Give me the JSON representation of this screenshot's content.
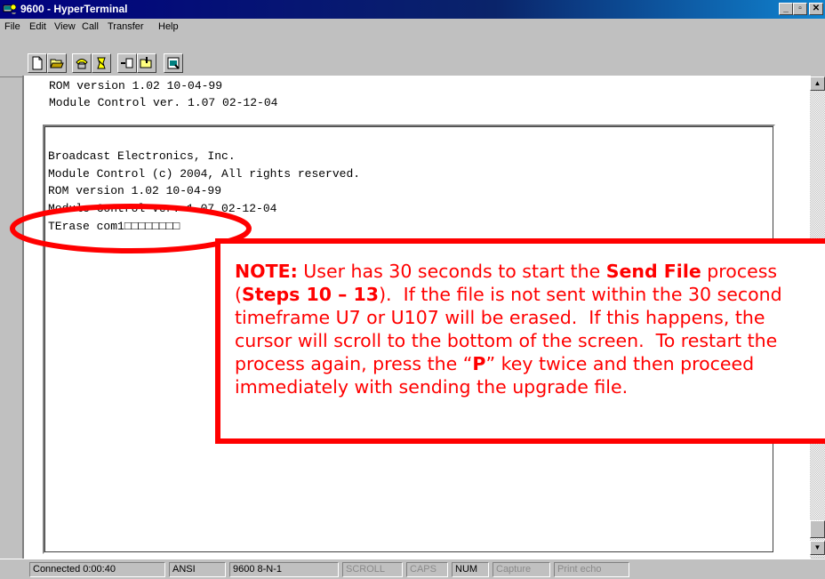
{
  "window": {
    "title": "9600 - HyperTerminal",
    "controls": {
      "minimize": "_",
      "maximize": "▫",
      "close": "✕"
    }
  },
  "menu": [
    "File",
    "Edit",
    "View",
    "Call",
    "Transfer",
    "Help"
  ],
  "toolbar": {
    "buttons": [
      "new-icon",
      "open-icon",
      "connect-icon",
      "disconnect-icon",
      "send-icon",
      "receive-icon",
      "properties-icon"
    ]
  },
  "terminal": {
    "upper_lines": [
      "ROM version 1.02 10-04-99",
      "Module Control ver. 1.07 02-12-04"
    ],
    "panel_lines": [
      "Broadcast Electronics, Inc.",
      "Module Control (c) 2004, All rights reserved.",
      "ROM version 1.02 10-04-99",
      "Module Control ver. 1.07 02-12-04",
      "TErase com1□□□□□□□□"
    ]
  },
  "note": {
    "label": "NOTE:",
    "t1": " User has 30 seconds to start the ",
    "b1": "Send File",
    "t2": " process",
    "t3": "(",
    "b2": "Steps 10 – 13",
    "t4": ").  If the file is not sent within the 30 second",
    "t5": "timeframe U7 or U107 will be erased.  If this happens, the",
    "t6": "cursor will scroll to the bottom of the screen.  To restart the",
    "t7": "process again, press the “",
    "b3": "P",
    "t8": "” key twice and then proceed",
    "t9": "immediately with sending the upgrade file.",
    "color": "#ff0000"
  },
  "statusbar": {
    "connected": "Connected 0:00:40",
    "emulation": "ANSI",
    "port_settings": "9600 8-N-1",
    "scroll": "SCROLL",
    "caps": "CAPS",
    "num": "NUM",
    "capture": "Capture",
    "print_echo": "Print echo"
  }
}
